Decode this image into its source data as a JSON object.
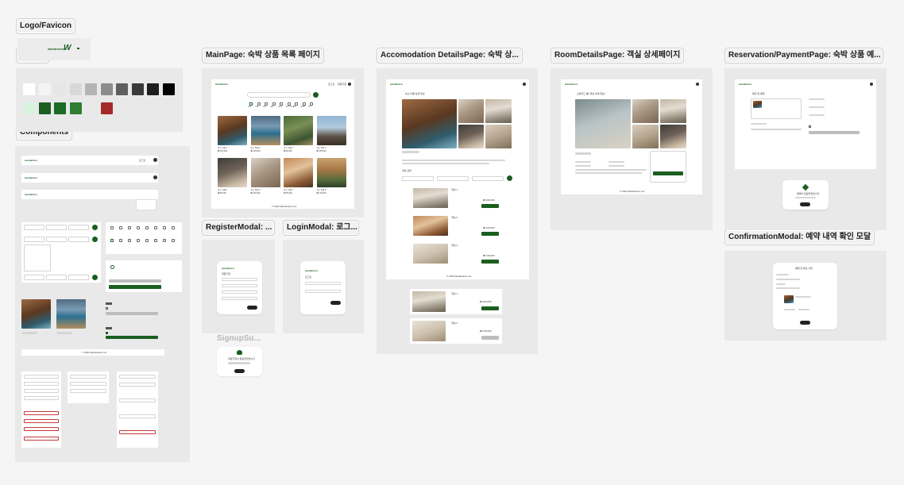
{
  "labels": {
    "logo": "Logo/Favicon",
    "colors": "Colors",
    "components": "Components",
    "main": "MainPage: 숙박 상품 목록 페이지",
    "accom": "Accomodation DetailsPage: 숙박 상...",
    "room": "RoomDetailsPage: 객실 상세페이지",
    "reserve": "Reservation/PaymentPage: 숙박 상품 예...",
    "register": "RegisterModal: ...",
    "login": "LoginModal: 로그...",
    "signup": "SignupSu...",
    "confirm": "ConfirmationModal: 예약 내역 확인 모달"
  },
  "logo": {
    "wordmark": "wanderlust",
    "favicon": "W"
  },
  "colors": {
    "grays": [
      "#ffffff",
      "#f4f4f4",
      "#e6e6e6",
      "#d8d8d8",
      "#b4b4b4",
      "#8c8c8c",
      "#5e5e5e",
      "#3a3a3a",
      "#1e1e1e",
      "#000000"
    ],
    "accents": [
      "#d8f2dd",
      "#1b5e20",
      "#196b26",
      "#2e7d32"
    ],
    "error": "#a52a2a"
  },
  "brand": "wanderlust",
  "header": {
    "login": "로그인",
    "signup": "회원가입"
  },
  "main": {
    "search_button": "검색",
    "categories": [
      "전체",
      "호텔",
      "모텔",
      "펜션",
      "리조트",
      "게스트하우스",
      "캠핑",
      "글램핑",
      "한옥"
    ],
    "cards": [
      {
        "name": "숙소 이름 1",
        "price": "₩ 100,000"
      },
      {
        "name": "숙소 이름 2",
        "price": "₩ 120,000"
      },
      {
        "name": "숙소 이름 3",
        "price": "₩ 90,000"
      },
      {
        "name": "숙소 이름 4",
        "price": "₩ 150,000"
      },
      {
        "name": "숙소 이름 5",
        "price": "₩ 80,000"
      },
      {
        "name": "숙소 이름 6",
        "price": "₩ 110,000"
      },
      {
        "name": "숙소 이름 7",
        "price": "₩ 95,000"
      },
      {
        "name": "숙소 이름 8",
        "price": "₩ 130,000"
      }
    ],
    "footer": "© 2024 Wanderlust, Inc."
  },
  "accom": {
    "title": "숙소 이름 상세 정보",
    "subtitle": "객실 선택",
    "rooms": [
      {
        "name": "객실 1",
        "price": "₩ 100,000",
        "action": "예약하기"
      },
      {
        "name": "객실 2",
        "price": "₩ 120,000",
        "action": "예약하기"
      },
      {
        "name": "객실 3",
        "price": "₩ 140,000",
        "action": "예약하기"
      }
    ],
    "sold_out": "매진",
    "footer": "© 2024 Wanderlust, Inc."
  },
  "room": {
    "title": "스탠다드 룸 (객실 상세 정보)",
    "book": "예약하기",
    "footer": "© 2024 Wanderlust, Inc."
  },
  "reserve": {
    "title": "확인 및 결제",
    "pay": "결제하기",
    "success_title": "예약이 완료되었습니다",
    "ok": "확인"
  },
  "register": {
    "title": "회원가입",
    "submit": "가입"
  },
  "login": {
    "title": "로그인",
    "submit": "로그인"
  },
  "signup": {
    "title": "회원가입이 완료되었습니다",
    "ok": "확인"
  },
  "confirm": {
    "title": "결제 전 확인 사항",
    "ok": "확인"
  }
}
